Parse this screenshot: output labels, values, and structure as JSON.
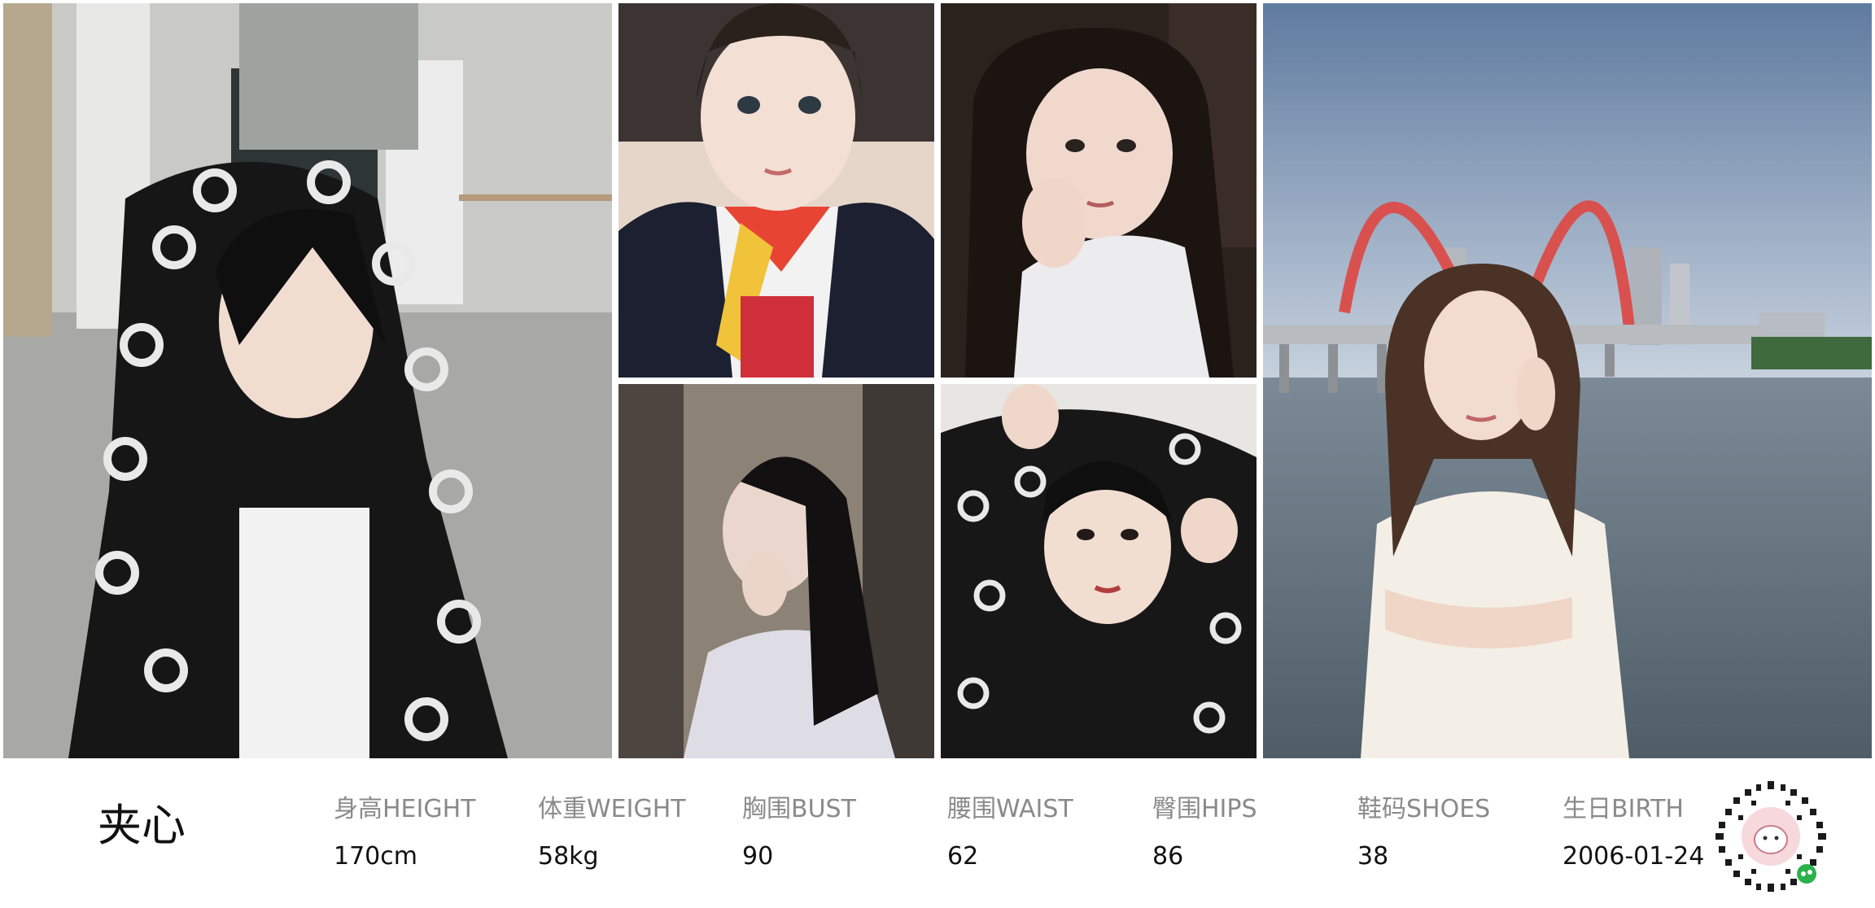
{
  "profile": {
    "name": "夹心",
    "stats": [
      {
        "label": "身高HEIGHT",
        "value": "170cm"
      },
      {
        "label": "体重WEIGHT",
        "value": "58kg"
      },
      {
        "label": "胸围BUST",
        "value": "90"
      },
      {
        "label": "腰围WAIST",
        "value": "62"
      },
      {
        "label": "臀围HIPS",
        "value": "86"
      },
      {
        "label": "鞋码SHOES",
        "value": "38"
      },
      {
        "label": "生日BIRTH",
        "value": "2006-01-24"
      }
    ]
  },
  "photos": [
    {
      "icon": "portrait-hooded-jacket-photo"
    },
    {
      "icon": "selfie-scarf-photo"
    },
    {
      "icon": "portrait-night-photo"
    },
    {
      "icon": "portrait-alley-photo"
    },
    {
      "icon": "portrait-hood-hands-photo"
    },
    {
      "icon": "portrait-riverside-bridge-photo"
    }
  ],
  "qr": {
    "icon": "mini-program-qr-code-icon"
  },
  "colors": {
    "label": "#8a8a8a",
    "value": "#111111",
    "background": "#ffffff"
  }
}
